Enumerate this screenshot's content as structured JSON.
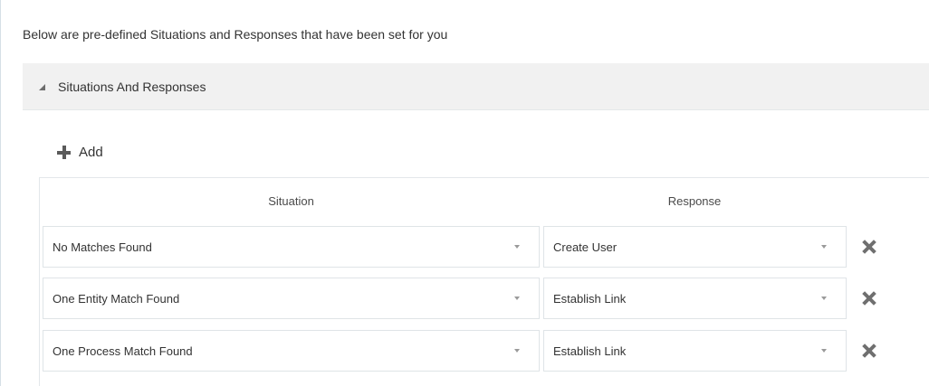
{
  "intro_text": "Below are pre-defined Situations and Responses that have been set for you",
  "section": {
    "title": "Situations And Responses",
    "collapse_icon": "triangle-expanded-icon"
  },
  "toolbar": {
    "add_label": "Add",
    "add_icon": "plus-icon"
  },
  "table": {
    "headers": {
      "situation": "Situation",
      "response": "Response"
    },
    "rows": [
      {
        "situation": "No Matches Found",
        "response": "Create User",
        "delete_icon": "close-x-icon"
      },
      {
        "situation": "One Entity Match Found",
        "response": "Establish Link",
        "delete_icon": "close-x-icon"
      },
      {
        "situation": "One Process Match Found",
        "response": "Establish Link",
        "delete_icon": "close-x-icon"
      }
    ]
  },
  "colors": {
    "header_bg": "#f1f1f1",
    "border": "#dfe4e7",
    "icon": "#6f6f6f"
  }
}
